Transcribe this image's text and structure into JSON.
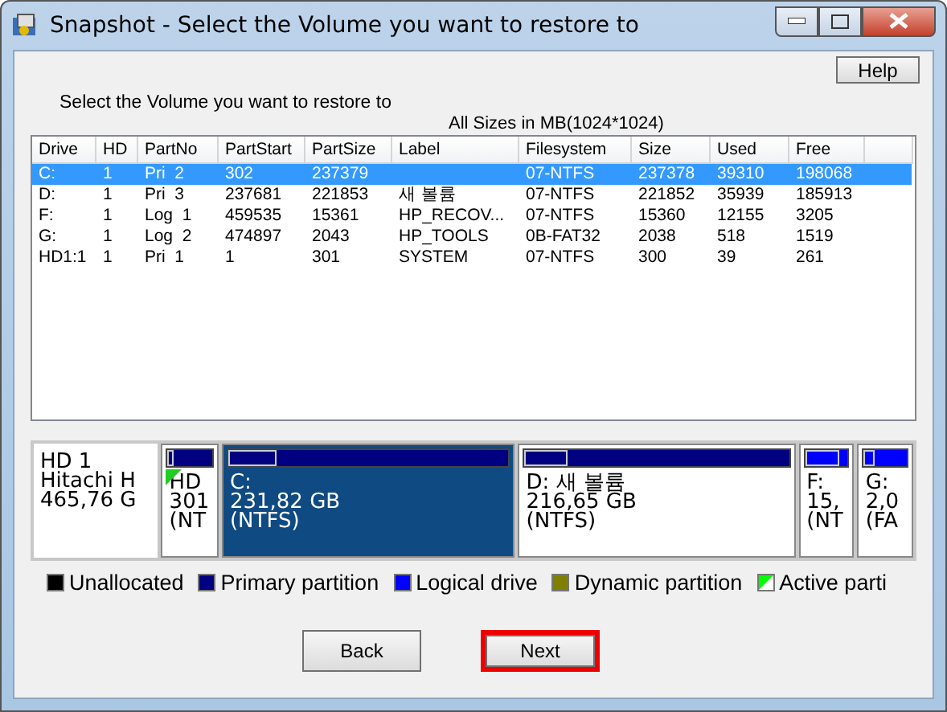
{
  "window": {
    "title": "Snapshot - Select the Volume you want to restore to"
  },
  "help_button": "Help",
  "instruction": "Select the Volume you want to restore to",
  "units_note": "All Sizes in MB(1024*1024)",
  "table": {
    "columns": [
      "Drive",
      "HD",
      "PartNo",
      "PartStart",
      "PartSize",
      "Label",
      "Filesystem",
      "Size",
      "Used",
      "Free"
    ],
    "rows": [
      {
        "cells": [
          "C:",
          "1",
          "Pri  2",
          "302",
          "237379",
          "",
          "07-NTFS",
          "237378",
          "39310",
          "198068"
        ],
        "selected": true
      },
      {
        "cells": [
          "D:",
          "1",
          "Pri  3",
          "237681",
          "221853",
          "새 볼륨",
          "07-NTFS",
          "221852",
          "35939",
          "185913"
        ],
        "selected": false
      },
      {
        "cells": [
          "F:",
          "1",
          "Log  1",
          "459535",
          "15361",
          "HP_RECOV...",
          "07-NTFS",
          "15360",
          "12155",
          "3205"
        ],
        "selected": false
      },
      {
        "cells": [
          "G:",
          "1",
          "Log  2",
          "474897",
          "2043",
          "HP_TOOLS",
          "0B-FAT32",
          "2038",
          "518",
          "1519"
        ],
        "selected": false
      },
      {
        "cells": [
          "HD1:1",
          "1",
          "Pri  1",
          "1",
          "301",
          "SYSTEM",
          "07-NTFS",
          "300",
          "39",
          "261"
        ],
        "selected": false
      }
    ]
  },
  "disk_map": {
    "disk": [
      "HD 1",
      "Hitachi H",
      "465,76 G"
    ],
    "partitions": [
      {
        "kind": "primary",
        "lines": [
          "HD",
          "301",
          "(NT"
        ],
        "level": 0.13,
        "active": true,
        "selected": false
      },
      {
        "kind": "primary",
        "lines": [
          "C:",
          "231,82 GB",
          "(NTFS)"
        ],
        "level": 0.17,
        "active": false,
        "selected": true
      },
      {
        "kind": "primary",
        "lines": [
          "D: 새 볼륨",
          "216,65 GB",
          "(NTFS)"
        ],
        "level": 0.16,
        "active": false,
        "selected": false
      },
      {
        "kind": "logical",
        "lines": [
          "F:",
          "15,",
          "(NT"
        ],
        "level": 0.79,
        "active": false,
        "selected": false
      },
      {
        "kind": "logical",
        "lines": [
          "G:",
          "2,0",
          "(FA"
        ],
        "level": 0.25,
        "active": false,
        "selected": false
      }
    ]
  },
  "legend": [
    {
      "kind": "swatch",
      "label": "Unallocated",
      "color": "#000000"
    },
    {
      "kind": "swatch",
      "label": "Primary partition",
      "color": "#000080"
    },
    {
      "kind": "swatch",
      "label": "Logical drive",
      "color": "#0000ff"
    },
    {
      "kind": "swatch",
      "label": "Dynamic partition",
      "color": "#808000"
    },
    {
      "kind": "active",
      "label": "Active parti",
      "color": "#00ff00"
    }
  ],
  "buttons": [
    {
      "label": "Back",
      "highlighted": false
    },
    {
      "label": "Next",
      "highlighted": true
    }
  ]
}
